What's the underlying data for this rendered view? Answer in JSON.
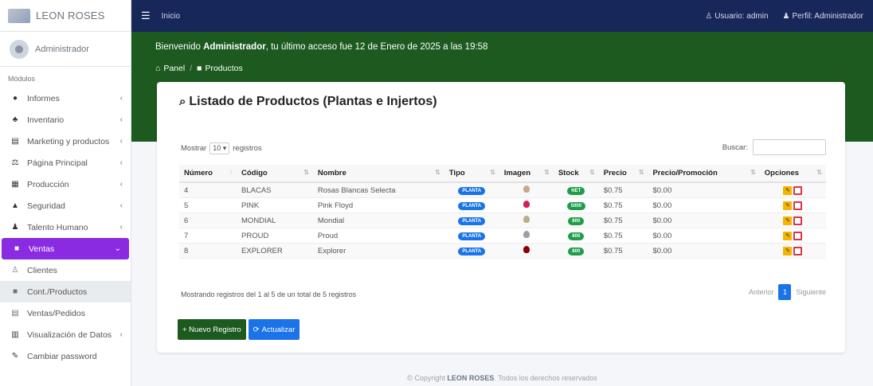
{
  "brand": {
    "name": "LEON ROSES"
  },
  "user": {
    "name": "Administrador"
  },
  "sidebar": {
    "header": "Módulos",
    "items": [
      {
        "label": "Informes",
        "icon": "globe-icon",
        "glyph": "●",
        "arrow": "‹"
      },
      {
        "label": "Inventario",
        "icon": "users-icon",
        "glyph": "♣",
        "arrow": "‹"
      },
      {
        "label": "Marketing y productos",
        "icon": "shop-icon",
        "glyph": "▤",
        "arrow": "‹"
      },
      {
        "label": "Página Principal",
        "icon": "balance-icon",
        "glyph": "⚖",
        "arrow": "‹"
      },
      {
        "label": "Producción",
        "icon": "calendar-icon",
        "glyph": "▦",
        "arrow": "‹"
      },
      {
        "label": "Seguridad",
        "icon": "lock-icon",
        "glyph": "▲",
        "arrow": "‹"
      },
      {
        "label": "Talento Humano",
        "icon": "people-icon",
        "glyph": "♟",
        "arrow": "‹"
      },
      {
        "label": "Ventas",
        "icon": "briefcase-icon",
        "glyph": "■",
        "arrow": "⌄"
      },
      {
        "label": "Clientes",
        "icon": "user-plus-icon",
        "glyph": "♙"
      },
      {
        "label": "Cont./Productos",
        "icon": "box-icon",
        "glyph": "■"
      },
      {
        "label": "Ventas/Pedidos",
        "icon": "store-icon",
        "glyph": "▤"
      },
      {
        "label": "Visualización de Datos",
        "icon": "chart-icon",
        "glyph": "▥",
        "arrow": "‹"
      },
      {
        "label": "Cambiar password",
        "icon": "key-icon",
        "glyph": "✎"
      }
    ]
  },
  "topbar": {
    "home_label": "Inicio",
    "user_label": "Usuario: admin",
    "profile_label": "Perfil: Administrador"
  },
  "welcome": {
    "prefix": "Bienvenido ",
    "name": "Administrador",
    "suffix": ", tu último acceso fue 12 de Enero de 2025 a las 19:58"
  },
  "breadcrumb": {
    "home": "Panel",
    "current": "Productos"
  },
  "card": {
    "title": "Listado de Productos (Plantas e Injertos)",
    "show_label": "Mostrar",
    "show_value": "10",
    "entries_label": "registros",
    "search_label": "Buscar:",
    "info": "Mostrando registros del 1 al 5 de un total de 5 registros",
    "prev_label": "Anterior",
    "page": "1",
    "next_label": "Siguiente",
    "new_button": "+ Nuevo Registro",
    "refresh_button": "Actualizar"
  },
  "table": {
    "columns": [
      "Número",
      "Código",
      "Nombre",
      "Tipo",
      "Imagen",
      "Stock",
      "Precio",
      "Precio/Promoción",
      "Opciones"
    ],
    "rows": [
      {
        "numero": "4",
        "codigo": "BLACAS",
        "nombre": "Rosas Blancas Selecta",
        "tipo": "PLANTA",
        "color": "#c9a88a",
        "stock": "NET",
        "precio": "$0.75",
        "promo": "$0.00"
      },
      {
        "numero": "5",
        "codigo": "PINK",
        "nombre": "Pink Floyd",
        "tipo": "PLANTA",
        "color": "#d81b60",
        "stock": "5000",
        "precio": "$0.75",
        "promo": "$0.00"
      },
      {
        "numero": "6",
        "codigo": "MONDIAL",
        "nombre": "Mondial",
        "tipo": "PLANTA",
        "color": "#b7b08a",
        "stock": "800",
        "precio": "$0.75",
        "promo": "$0.00"
      },
      {
        "numero": "7",
        "codigo": "PROUD",
        "nombre": "Proud",
        "tipo": "PLANTA",
        "color": "#9aa0a6",
        "stock": "800",
        "precio": "$0.75",
        "promo": "$0.00"
      },
      {
        "numero": "8",
        "codigo": "EXPLORER",
        "nombre": "Explorer",
        "tipo": "PLANTA",
        "color": "#8b0000",
        "stock": "800",
        "precio": "$0.75",
        "promo": "$0.00"
      }
    ]
  },
  "footer": {
    "prefix": "© Copyright ",
    "brand": "LEON ROSES",
    "suffix": ". Todos los derechos reservados"
  }
}
